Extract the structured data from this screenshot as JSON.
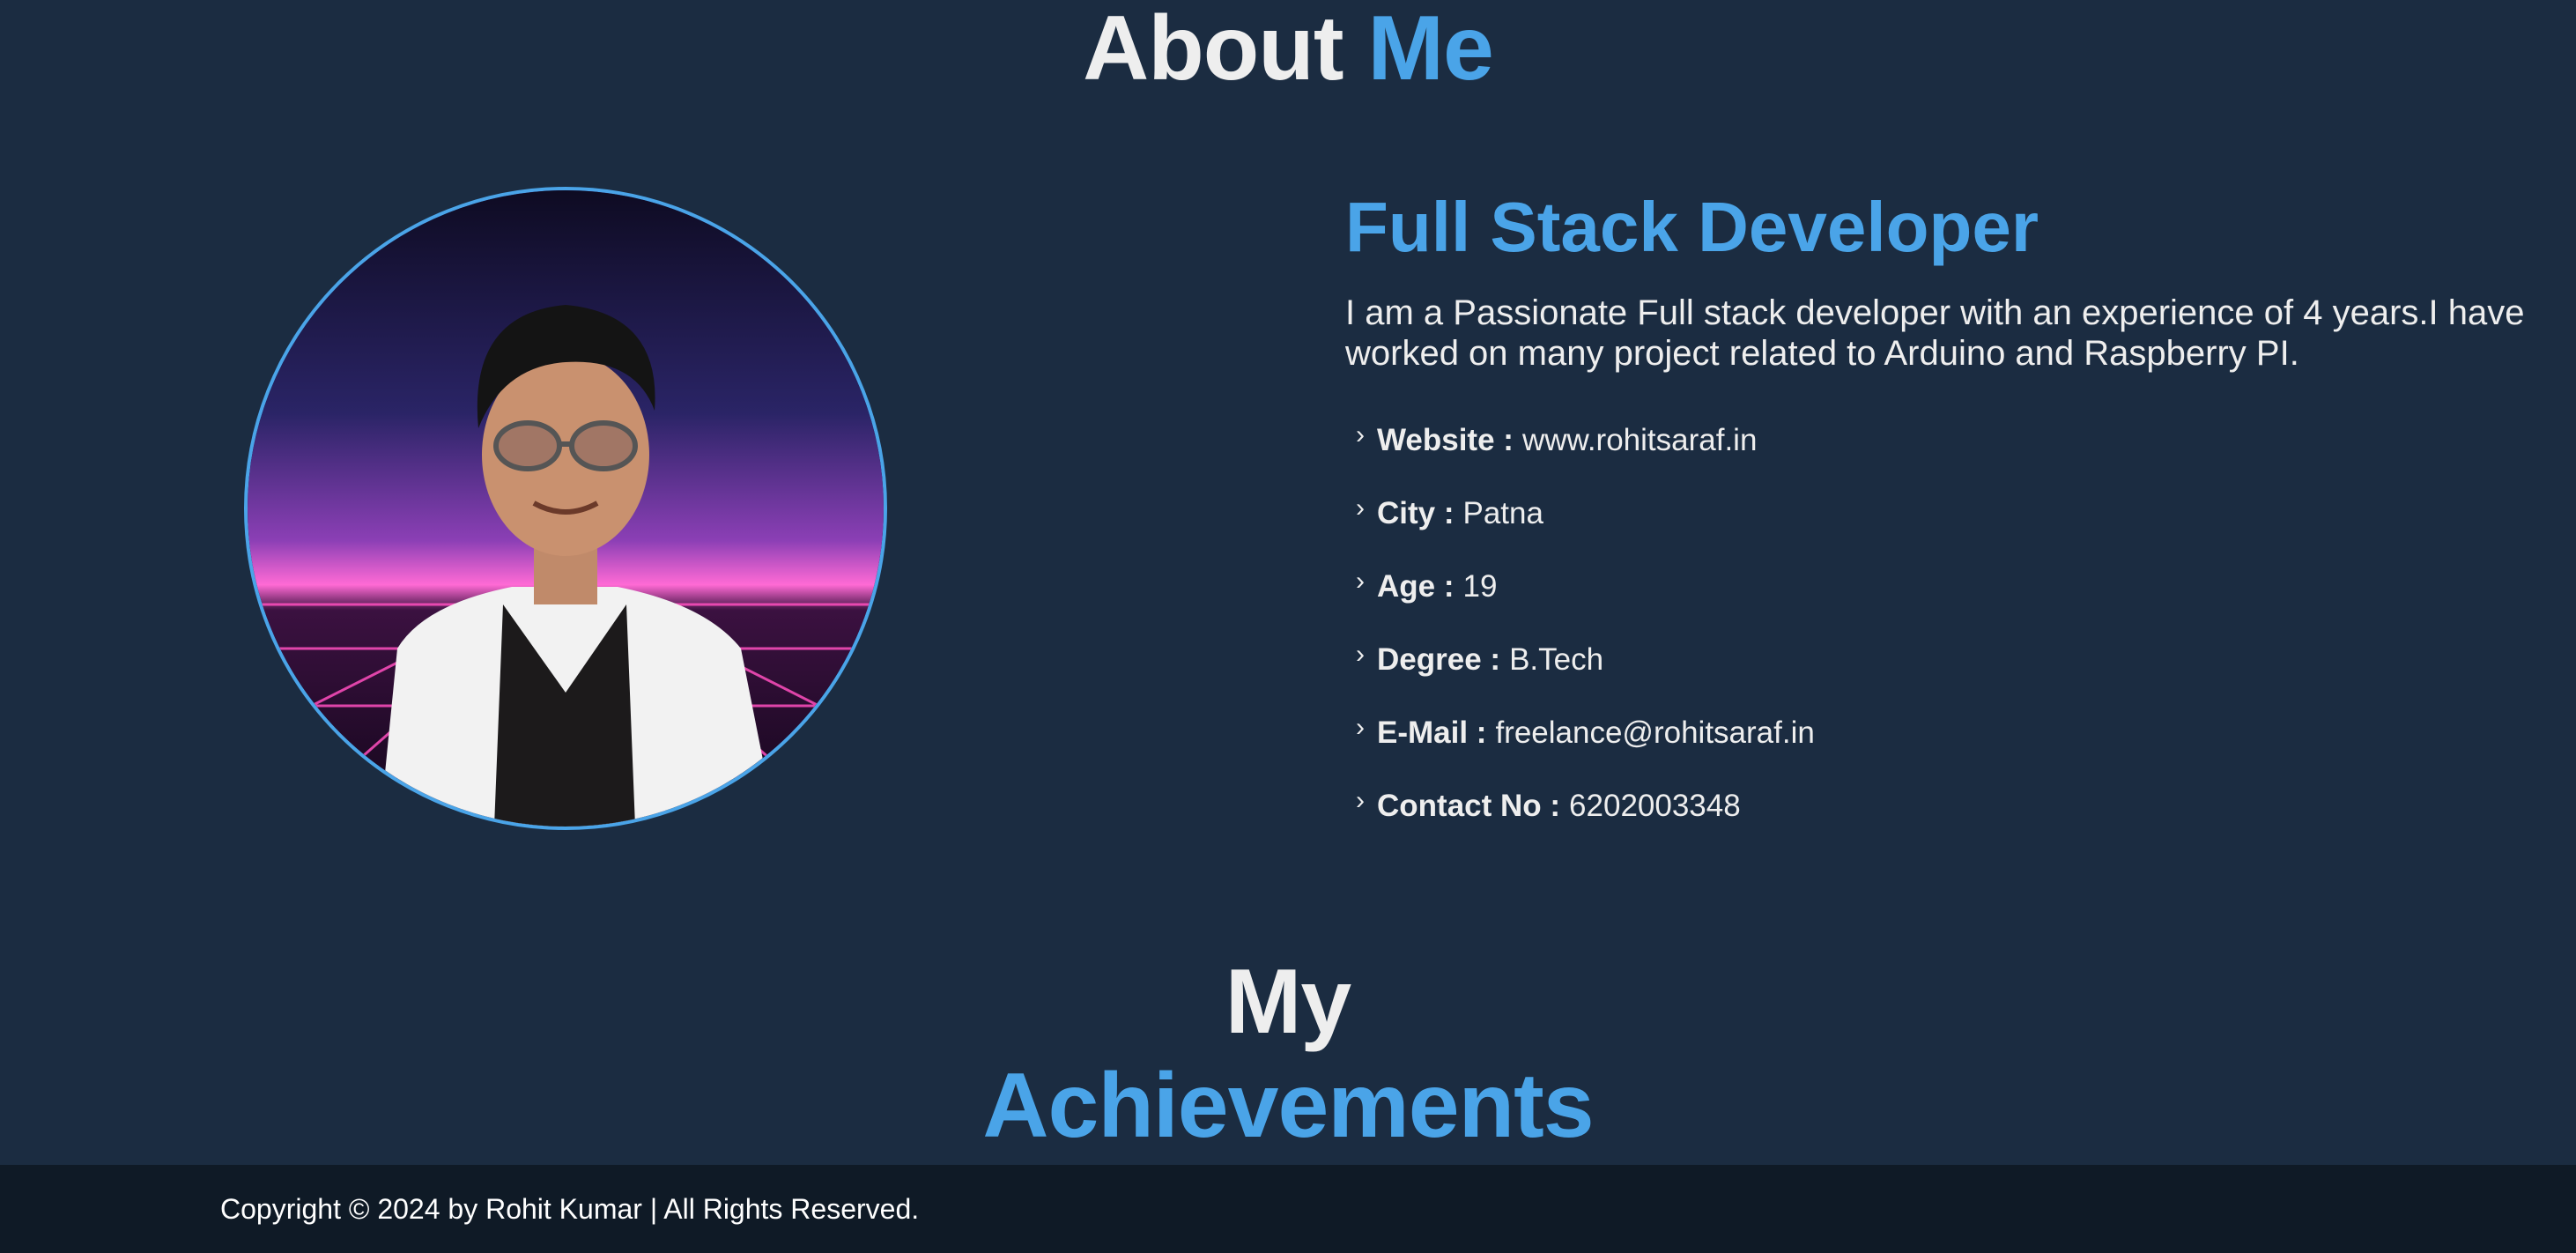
{
  "about": {
    "title_main": "About",
    "title_accent": "Me"
  },
  "profile": {
    "photo_alt": "Profile photo of Rohit Kumar",
    "role": "Full Stack Developer",
    "bio": "I am a Passionate Full stack developer with an experience of 4 years.I have worked on many project related to Arduino and Raspberry PI.",
    "details": [
      {
        "label": "Website :",
        "value": "www.rohitsaraf.in"
      },
      {
        "label": "City :",
        "value": "Patna"
      },
      {
        "label": "Age :",
        "value": "19"
      },
      {
        "label": "Degree :",
        "value": "B.Tech"
      },
      {
        "label": "E-Mail :",
        "value": "freelance@rohitsaraf.in"
      },
      {
        "label": "Contact No :",
        "value": "6202003348"
      }
    ],
    "chevron_icon": "chevron-right-icon"
  },
  "achievements": {
    "title_main": "My",
    "title_accent": "Achievements"
  },
  "footer": {
    "copyright": "Copyright © 2024 by Rohit Kumar | All Rights Reserved."
  },
  "colors": {
    "background": "#1b2c41",
    "accent": "#4aa4e8",
    "footer_bg": "#0f1a26",
    "text": "#eeeeee"
  }
}
